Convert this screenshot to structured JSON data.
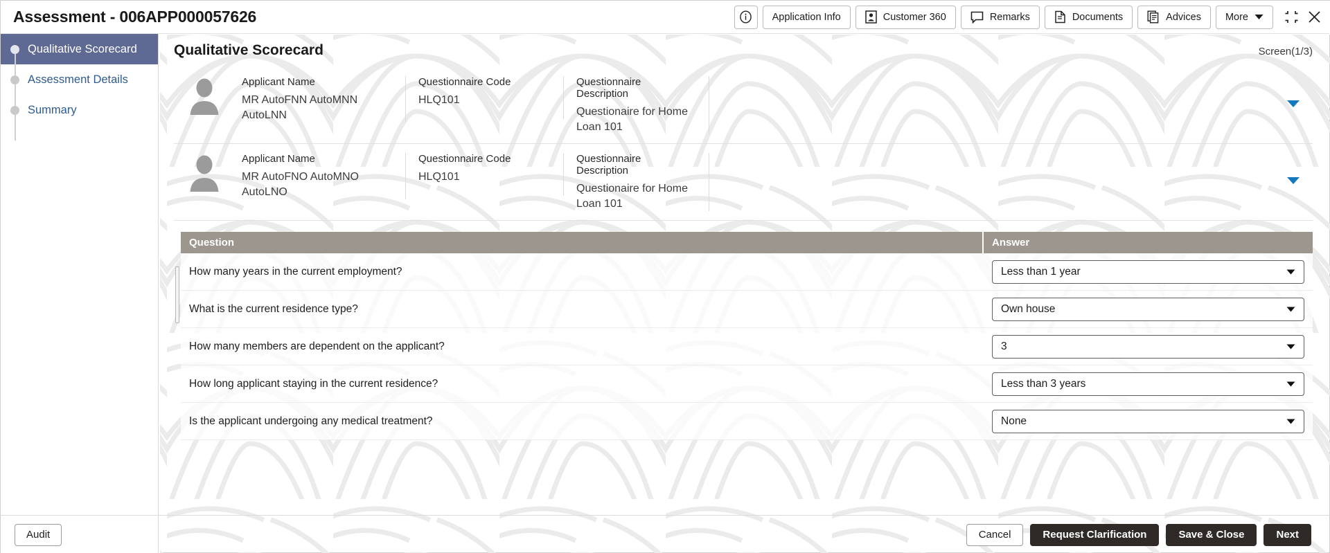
{
  "window": {
    "title": "Assessment - 006APP000057626",
    "controls": [
      {
        "name": "minimize-restore-icon",
        "label": "minimize"
      },
      {
        "name": "close-icon",
        "label": "close"
      }
    ]
  },
  "toolbar": {
    "buttons": [
      {
        "name": "info-button",
        "label": "",
        "icon": "info-icon",
        "icon_only": true
      },
      {
        "name": "application-info-button",
        "label": "Application Info",
        "icon": "none"
      },
      {
        "name": "customer-360-button",
        "label": "Customer 360",
        "icon": "contact-card-icon"
      },
      {
        "name": "remarks-button",
        "label": "Remarks",
        "icon": "speech-bubble-icon"
      },
      {
        "name": "documents-button",
        "label": "Documents",
        "icon": "document-icon"
      },
      {
        "name": "advices-button",
        "label": "Advices",
        "icon": "documents-stack-icon"
      },
      {
        "name": "more-button",
        "label": "More",
        "icon": "chevron-down-icon"
      }
    ]
  },
  "sidebar": {
    "items": [
      {
        "label": "Qualitative Scorecard",
        "active": true
      },
      {
        "label": "Assessment Details",
        "active": false
      },
      {
        "label": "Summary",
        "active": false
      }
    ],
    "audit_label": "Audit"
  },
  "main": {
    "page_title": "Qualitative Scorecard",
    "screen_counter": "Screen(1/3)",
    "applicants": [
      {
        "name_label": "Applicant Name",
        "name_value": "MR AutoFNN AutoMNN AutoLNN",
        "code_label": "Questionnaire Code",
        "code_value": "HLQ101",
        "desc_label": "Questionnaire Description",
        "desc_value": "Questionaire for Home Loan 101"
      },
      {
        "name_label": "Applicant Name",
        "name_value": "MR AutoFNO AutoMNO AutoLNO",
        "code_label": "Questionnaire Code",
        "code_value": "HLQ101",
        "desc_label": "Questionnaire Description",
        "desc_value": "Questionaire for Home Loan 101"
      }
    ],
    "table": {
      "headers": {
        "question": "Question",
        "answer": "Answer"
      },
      "rows": [
        {
          "question": "How many years in the current employment?",
          "answer": "Less than 1 year"
        },
        {
          "question": "What is the current residence type?",
          "answer": "Own house"
        },
        {
          "question": "How many members are dependent on the applicant?",
          "answer": "3"
        },
        {
          "question": "How long applicant staying in the current residence?",
          "answer": "Less than 3 years"
        },
        {
          "question": "Is the applicant undergoing any medical treatment?",
          "answer": "None"
        }
      ]
    }
  },
  "footer": {
    "cancel_label": "Cancel",
    "request_clarification_label": "Request Clarification",
    "save_close_label": "Save & Close",
    "next_label": "Next"
  },
  "colors": {
    "sidebar_active": "#5e6a93",
    "sidebar_link": "#2f5b8f",
    "table_header": "#9d968f",
    "primary_button": "#2f2a27",
    "chevron_blue": "#1479bd"
  }
}
